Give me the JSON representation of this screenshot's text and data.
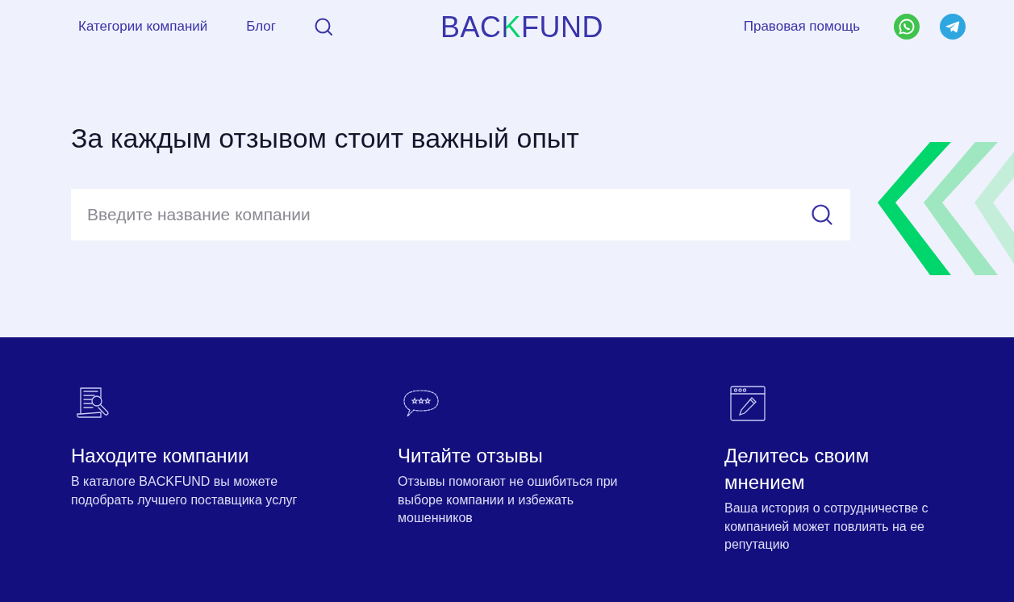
{
  "header": {
    "nav_left": [
      {
        "label": "Категории компаний"
      },
      {
        "label": "Блог"
      }
    ],
    "logo": {
      "parts": [
        {
          "text": "BAC",
          "accent": false
        },
        {
          "text": "K",
          "accent": true
        },
        {
          "text": "FUND",
          "accent": false
        }
      ]
    },
    "nav_right": [
      {
        "label": "Правовая помощь"
      }
    ]
  },
  "hero": {
    "title": "За каждым отзывом стоит важный опыт",
    "search": {
      "placeholder": "Введите название компании"
    }
  },
  "features": [
    {
      "title": "Находите компании",
      "text": "В каталоге BACKFUND вы можете подобрать лучшего поставщика услуг"
    },
    {
      "title": "Читайте отзывы",
      "text": "Отзывы помогают не ошибиться при выборе компании и избежать мошенников"
    },
    {
      "title": "Делитесь своим мнением",
      "text": "Ваша история о сотрудничестве с компанией может повлиять на ее репутацию"
    }
  ]
}
